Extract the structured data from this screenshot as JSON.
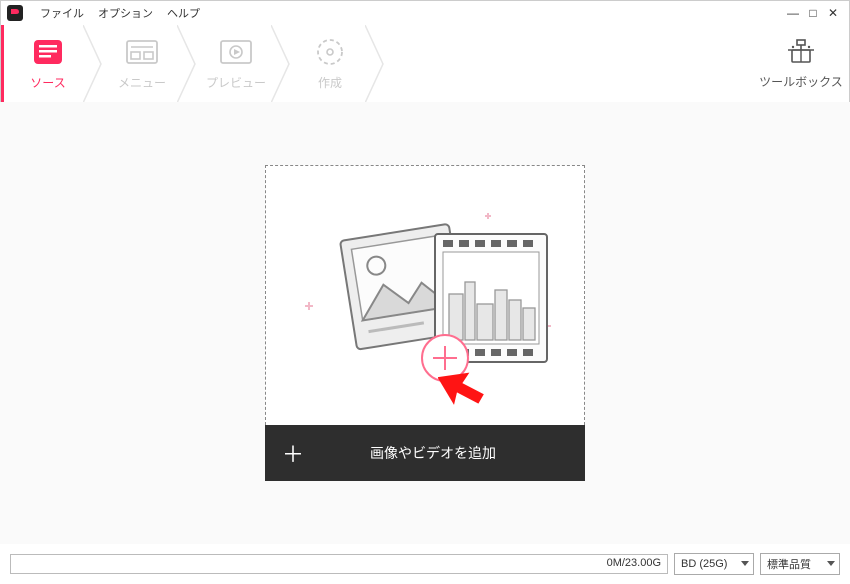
{
  "menubar": {
    "file": "ファイル",
    "option": "オプション",
    "help": "ヘルプ"
  },
  "window": {
    "min": "—",
    "max": "□",
    "close": "✕"
  },
  "nav": {
    "steps": [
      {
        "label": "ソース"
      },
      {
        "label": "メニュー"
      },
      {
        "label": "プレビュー"
      },
      {
        "label": "作成"
      }
    ],
    "toolbox": "ツールボックス"
  },
  "drop": {
    "add_label": "画像やビデオを追加",
    "plus": "＋"
  },
  "status": {
    "progress_text": "0M/23.00G",
    "disc_select": "BD (25G)",
    "quality_select": "標準品質"
  },
  "colors": {
    "accent": "#ff2a5f"
  }
}
